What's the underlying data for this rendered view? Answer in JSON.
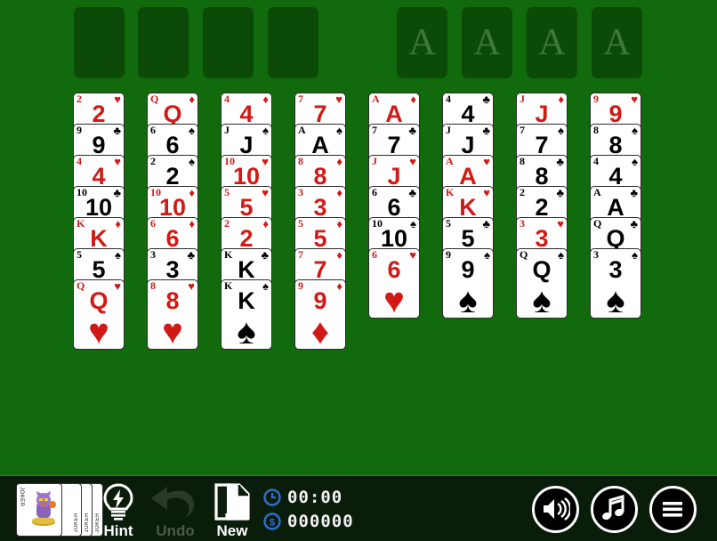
{
  "game": {
    "title": "FreeCell",
    "table_color": "#116b0c",
    "slot_color": "#0b4a07",
    "card_red": "#d11a15",
    "card_black": "#000000",
    "toolbar_color": "#0a1c0a"
  },
  "free_cells": [
    {
      "name": "free-cell-1",
      "card": null,
      "placeholder": ""
    },
    {
      "name": "free-cell-2",
      "card": null,
      "placeholder": ""
    },
    {
      "name": "free-cell-3",
      "card": null,
      "placeholder": ""
    },
    {
      "name": "free-cell-4",
      "card": null,
      "placeholder": ""
    }
  ],
  "foundations": [
    {
      "name": "foundation-1",
      "card": null,
      "placeholder": "A"
    },
    {
      "name": "foundation-2",
      "card": null,
      "placeholder": "A"
    },
    {
      "name": "foundation-3",
      "card": null,
      "placeholder": "A"
    },
    {
      "name": "foundation-4",
      "card": null,
      "placeholder": "A"
    }
  ],
  "tableau": [
    {
      "name": "tableau-column-1",
      "cards": [
        {
          "rank": "2",
          "suit": "hearts",
          "pip": "♥",
          "color": "red"
        },
        {
          "rank": "9",
          "suit": "clubs",
          "pip": "♣",
          "color": "black"
        },
        {
          "rank": "4",
          "suit": "hearts",
          "pip": "♥",
          "color": "red"
        },
        {
          "rank": "10",
          "suit": "clubs",
          "pip": "♣",
          "color": "black"
        },
        {
          "rank": "K",
          "suit": "diamonds",
          "pip": "♦",
          "color": "red"
        },
        {
          "rank": "5",
          "suit": "spades",
          "pip": "♠",
          "color": "black"
        },
        {
          "rank": "Q",
          "suit": "hearts",
          "pip": "♥",
          "color": "red"
        }
      ]
    },
    {
      "name": "tableau-column-2",
      "cards": [
        {
          "rank": "Q",
          "suit": "diamonds",
          "pip": "♦",
          "color": "red"
        },
        {
          "rank": "6",
          "suit": "spades",
          "pip": "♠",
          "color": "black"
        },
        {
          "rank": "2",
          "suit": "spades",
          "pip": "♠",
          "color": "black"
        },
        {
          "rank": "10",
          "suit": "diamonds",
          "pip": "♦",
          "color": "red"
        },
        {
          "rank": "6",
          "suit": "diamonds",
          "pip": "♦",
          "color": "red"
        },
        {
          "rank": "3",
          "suit": "clubs",
          "pip": "♣",
          "color": "black"
        },
        {
          "rank": "8",
          "suit": "hearts",
          "pip": "♥",
          "color": "red"
        }
      ]
    },
    {
      "name": "tableau-column-3",
      "cards": [
        {
          "rank": "4",
          "suit": "diamonds",
          "pip": "♦",
          "color": "red"
        },
        {
          "rank": "J",
          "suit": "spades",
          "pip": "♠",
          "color": "black"
        },
        {
          "rank": "10",
          "suit": "hearts",
          "pip": "♥",
          "color": "red"
        },
        {
          "rank": "5",
          "suit": "hearts",
          "pip": "♥",
          "color": "red"
        },
        {
          "rank": "2",
          "suit": "diamonds",
          "pip": "♦",
          "color": "red"
        },
        {
          "rank": "K",
          "suit": "clubs",
          "pip": "♣",
          "color": "black"
        },
        {
          "rank": "K",
          "suit": "spades",
          "pip": "♠",
          "color": "black"
        }
      ]
    },
    {
      "name": "tableau-column-4",
      "cards": [
        {
          "rank": "7",
          "suit": "hearts",
          "pip": "♥",
          "color": "red"
        },
        {
          "rank": "A",
          "suit": "spades",
          "pip": "♠",
          "color": "black"
        },
        {
          "rank": "8",
          "suit": "diamonds",
          "pip": "♦",
          "color": "red"
        },
        {
          "rank": "3",
          "suit": "diamonds",
          "pip": "♦",
          "color": "red"
        },
        {
          "rank": "5",
          "suit": "diamonds",
          "pip": "♦",
          "color": "red"
        },
        {
          "rank": "7",
          "suit": "diamonds",
          "pip": "♦",
          "color": "red"
        },
        {
          "rank": "9",
          "suit": "diamonds",
          "pip": "♦",
          "color": "red"
        }
      ]
    },
    {
      "name": "tableau-column-5",
      "cards": [
        {
          "rank": "A",
          "suit": "diamonds",
          "pip": "♦",
          "color": "red"
        },
        {
          "rank": "7",
          "suit": "clubs",
          "pip": "♣",
          "color": "black"
        },
        {
          "rank": "J",
          "suit": "hearts",
          "pip": "♥",
          "color": "red"
        },
        {
          "rank": "6",
          "suit": "clubs",
          "pip": "♣",
          "color": "black"
        },
        {
          "rank": "10",
          "suit": "spades",
          "pip": "♠",
          "color": "black"
        },
        {
          "rank": "6",
          "suit": "hearts",
          "pip": "♥",
          "color": "red"
        }
      ]
    },
    {
      "name": "tableau-column-6",
      "cards": [
        {
          "rank": "4",
          "suit": "clubs",
          "pip": "♣",
          "color": "black"
        },
        {
          "rank": "J",
          "suit": "clubs",
          "pip": "♣",
          "color": "black"
        },
        {
          "rank": "A",
          "suit": "hearts",
          "pip": "♥",
          "color": "red"
        },
        {
          "rank": "K",
          "suit": "hearts",
          "pip": "♥",
          "color": "red"
        },
        {
          "rank": "5",
          "suit": "clubs",
          "pip": "♣",
          "color": "black"
        },
        {
          "rank": "9",
          "suit": "spades",
          "pip": "♠",
          "color": "black"
        }
      ]
    },
    {
      "name": "tableau-column-7",
      "cards": [
        {
          "rank": "J",
          "suit": "diamonds",
          "pip": "♦",
          "color": "red"
        },
        {
          "rank": "7",
          "suit": "spades",
          "pip": "♠",
          "color": "black"
        },
        {
          "rank": "8",
          "suit": "clubs",
          "pip": "♣",
          "color": "black"
        },
        {
          "rank": "2",
          "suit": "clubs",
          "pip": "♣",
          "color": "black"
        },
        {
          "rank": "3",
          "suit": "hearts",
          "pip": "♥",
          "color": "red"
        },
        {
          "rank": "Q",
          "suit": "spades",
          "pip": "♠",
          "color": "black"
        }
      ]
    },
    {
      "name": "tableau-column-8",
      "cards": [
        {
          "rank": "9",
          "suit": "hearts",
          "pip": "♥",
          "color": "red"
        },
        {
          "rank": "8",
          "suit": "spades",
          "pip": "♠",
          "color": "black"
        },
        {
          "rank": "4",
          "suit": "spades",
          "pip": "♠",
          "color": "black"
        },
        {
          "rank": "A",
          "suit": "clubs",
          "pip": "♣",
          "color": "black"
        },
        {
          "rank": "Q",
          "suit": "clubs",
          "pip": "♣",
          "color": "black"
        },
        {
          "rank": "3",
          "suit": "spades",
          "pip": "♠",
          "color": "black"
        }
      ]
    }
  ],
  "toolbar": {
    "deck": {
      "label": "JOKER"
    },
    "hint": {
      "label": "Hint",
      "enabled": true
    },
    "undo": {
      "label": "Undo",
      "enabled": false
    },
    "new": {
      "label": "New",
      "enabled": true
    },
    "timer": {
      "value": "00:00"
    },
    "score": {
      "value": "000000"
    },
    "sound_button": "sound-button",
    "music_button": "music-button",
    "menu_button": "menu-button"
  }
}
